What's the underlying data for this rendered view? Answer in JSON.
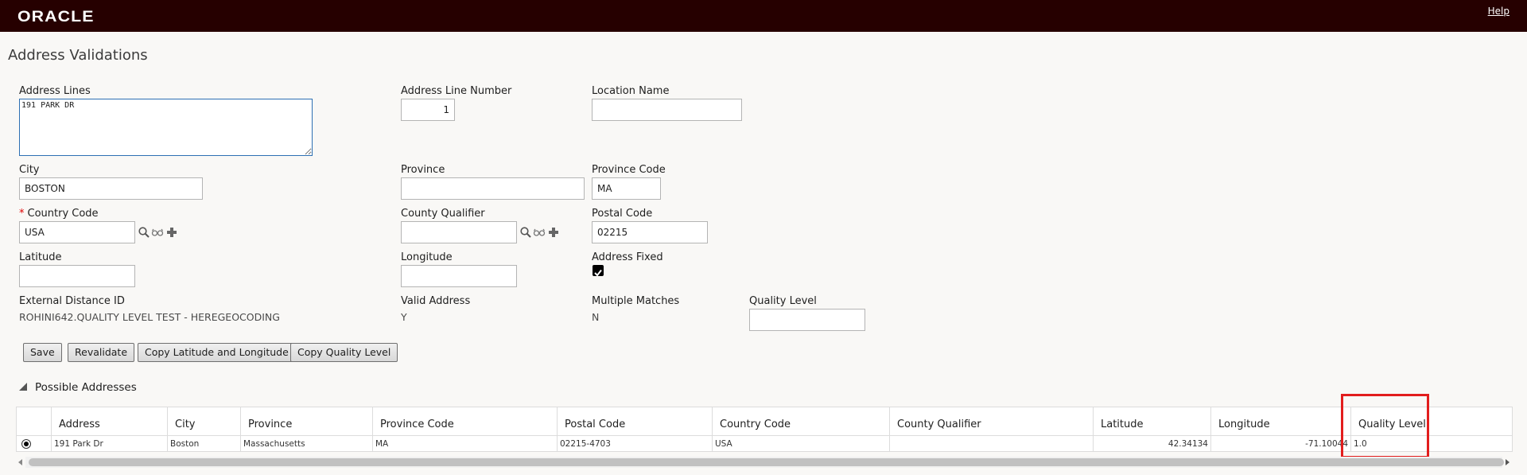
{
  "header": {
    "logo": "ORACLE",
    "help": "Help"
  },
  "page_title": "Address Validations",
  "form": {
    "address_lines": {
      "label": "Address Lines",
      "value": "191 PARK DR"
    },
    "address_line_number": {
      "label": "Address Line Number",
      "value": "1"
    },
    "location_name": {
      "label": "Location Name",
      "value": ""
    },
    "city": {
      "label": "City",
      "value": "BOSTON"
    },
    "province": {
      "label": "Province",
      "value": ""
    },
    "province_code": {
      "label": "Province Code",
      "value": "MA"
    },
    "country_code": {
      "label": "Country Code",
      "required_mark": "*",
      "value": "USA"
    },
    "county_qualifier": {
      "label": "County Qualifier",
      "value": ""
    },
    "postal_code": {
      "label": "Postal Code",
      "value": "02215"
    },
    "latitude": {
      "label": "Latitude",
      "value": ""
    },
    "longitude": {
      "label": "Longitude",
      "value": ""
    },
    "address_fixed": {
      "label": "Address Fixed",
      "checked": true
    },
    "external_distance_id": {
      "label": "External Distance ID",
      "value": "ROHINI642.QUALITY LEVEL TEST - HEREGEOCODING"
    },
    "valid_address": {
      "label": "Valid Address",
      "value": "Y"
    },
    "multiple_matches": {
      "label": "Multiple Matches",
      "value": "N"
    },
    "quality_level": {
      "label": "Quality Level",
      "value": ""
    }
  },
  "buttons": {
    "save": "Save",
    "revalidate": "Revalidate",
    "copy_lat_long": "Copy Latitude and Longitude",
    "copy_quality": "Copy Quality Level"
  },
  "possible_addresses": {
    "title": "Possible Addresses",
    "columns": [
      "Address",
      "City",
      "Province",
      "Province Code",
      "Postal Code",
      "Country Code",
      "County Qualifier",
      "Latitude",
      "Longitude",
      "Quality Level"
    ],
    "rows": [
      {
        "address": "191 Park Dr",
        "city": "Boston",
        "province": "Massachusetts",
        "province_code": "MA",
        "postal_code": "02215-4703",
        "country_code": "USA",
        "county_qualifier": "",
        "latitude": "42.34134",
        "longitude": "-71.10044",
        "quality_level": "1.0"
      }
    ]
  },
  "colors": {
    "header_bg": "#260000",
    "highlight": "#e21d1d",
    "focus_border": "#2d6fb3"
  },
  "icons": [
    "search-icon",
    "view-icon",
    "add-icon",
    "collapse-triangle-icon"
  ]
}
